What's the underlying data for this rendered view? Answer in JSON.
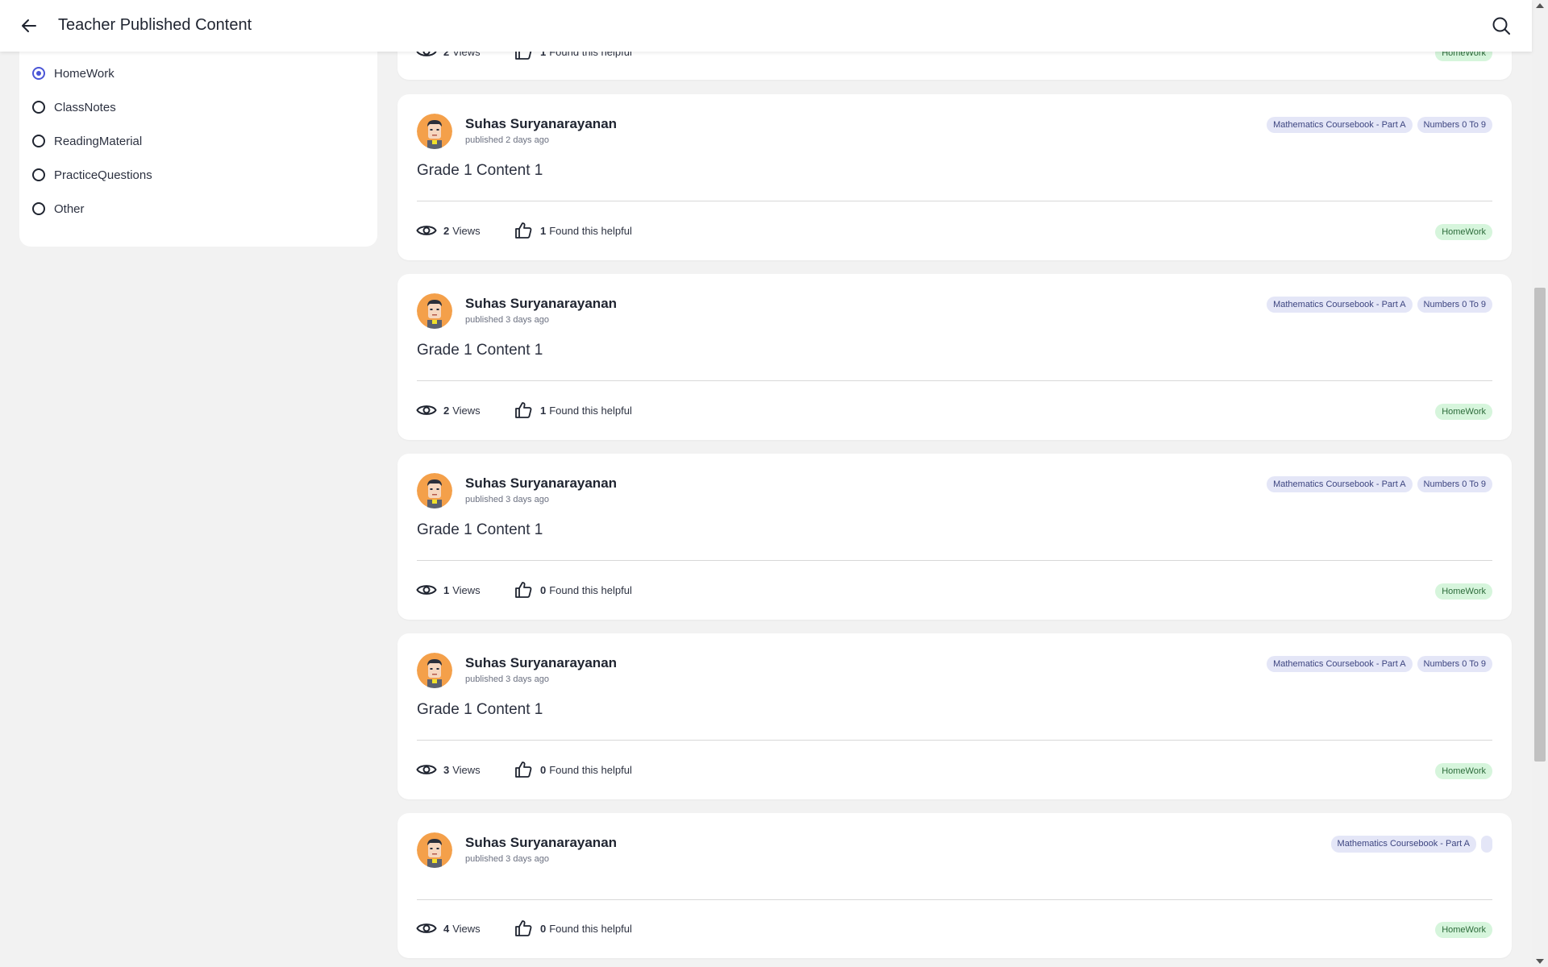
{
  "header": {
    "title": "Teacher Published Content"
  },
  "filters": {
    "options": [
      {
        "label": "HomeWork",
        "checked": true
      },
      {
        "label": "ClassNotes",
        "checked": false
      },
      {
        "label": "ReadingMaterial",
        "checked": false
      },
      {
        "label": "PracticeQuestions",
        "checked": false
      },
      {
        "label": "Other",
        "checked": false
      }
    ]
  },
  "top_partial_card": {
    "views": "2",
    "views_label": "Views",
    "helpful": "1",
    "helpful_label": "Found this helpful",
    "category": "HomeWork"
  },
  "cards": [
    {
      "author": "Suhas Suryanarayanan",
      "published": "published 2 days ago",
      "tags": [
        "Mathematics Coursebook - Part A",
        "Numbers 0 To 9"
      ],
      "title": "Grade 1 Content 1",
      "views": "2",
      "views_label": "Views",
      "helpful": "1",
      "helpful_label": "Found this helpful",
      "category": "HomeWork"
    },
    {
      "author": "Suhas Suryanarayanan",
      "published": "published 3 days ago",
      "tags": [
        "Mathematics Coursebook - Part A",
        "Numbers 0 To 9"
      ],
      "title": "Grade 1 Content 1",
      "views": "2",
      "views_label": "Views",
      "helpful": "1",
      "helpful_label": "Found this helpful",
      "category": "HomeWork"
    },
    {
      "author": "Suhas Suryanarayanan",
      "published": "published 3 days ago",
      "tags": [
        "Mathematics Coursebook - Part A",
        "Numbers 0 To 9"
      ],
      "title": "Grade 1 Content 1",
      "views": "1",
      "views_label": "Views",
      "helpful": "0",
      "helpful_label": "Found this helpful",
      "category": "HomeWork"
    },
    {
      "author": "Suhas Suryanarayanan",
      "published": "published 3 days ago",
      "tags": [
        "Mathematics Coursebook - Part A",
        "Numbers 0 To 9"
      ],
      "title": "Grade 1 Content 1",
      "views": "3",
      "views_label": "Views",
      "helpful": "0",
      "helpful_label": "Found this helpful",
      "category": "HomeWork"
    },
    {
      "author": "Suhas Suryanarayanan",
      "published": "published 3 days ago",
      "tags": [
        "Mathematics Coursebook - Part A",
        ""
      ],
      "title": "",
      "views": "4",
      "views_label": "Views",
      "helpful": "0",
      "helpful_label": "Found this helpful",
      "category": "HomeWork"
    }
  ],
  "icons": {
    "back": "arrow-left-icon",
    "search": "search-icon",
    "views": "eye-icon",
    "helpful": "thumbs-up-icon",
    "avatar": "teacher-avatar"
  },
  "colors": {
    "accent": "#4a55d6",
    "tag_bg": "#e4e6f7",
    "category_bg": "#d6f5dc",
    "page_bg": "#f2f2f2"
  }
}
